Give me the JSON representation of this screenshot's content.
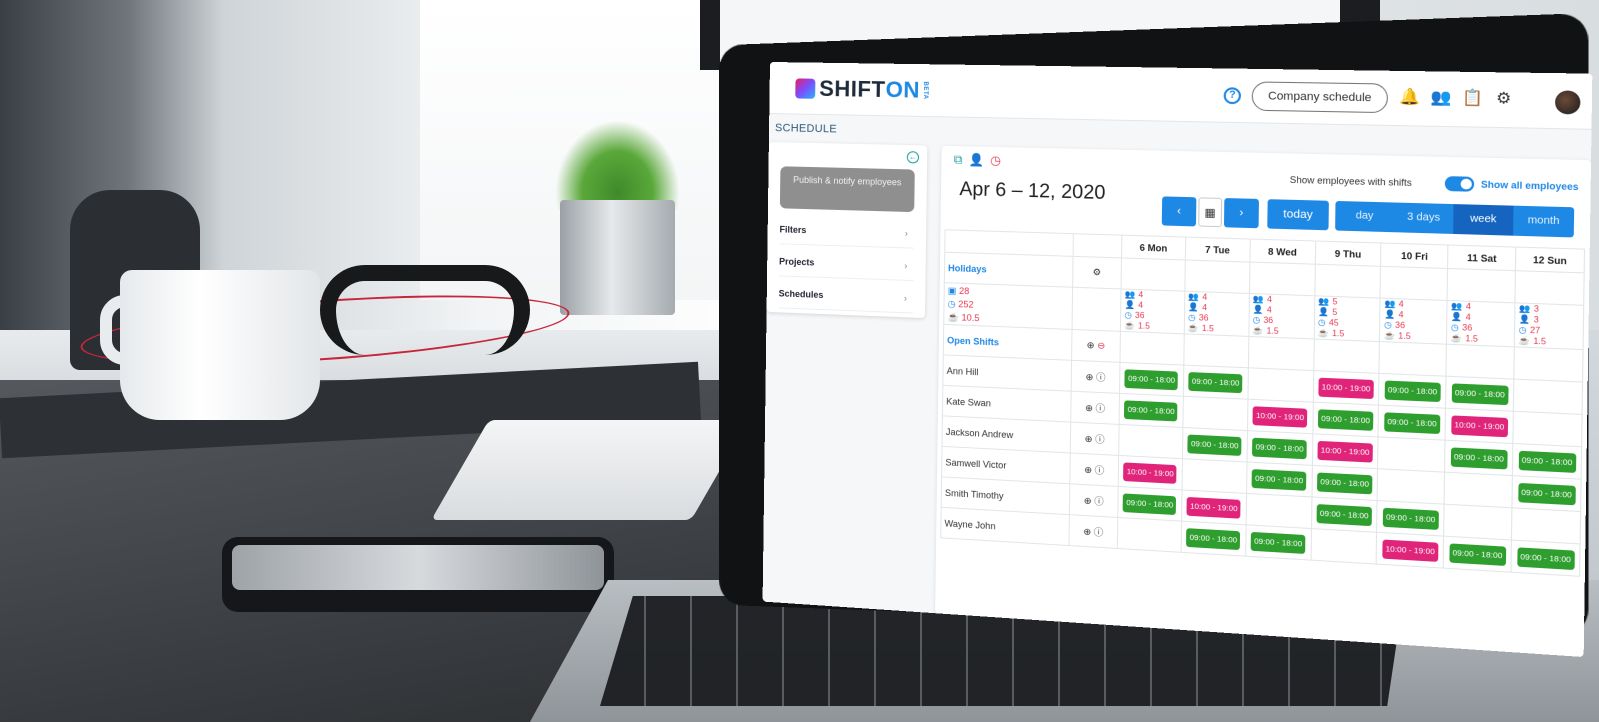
{
  "app": {
    "logo_main": "SHIFT",
    "logo_accent": "ON",
    "logo_badge": "BETA",
    "page_label": "SCHEDULE"
  },
  "topbar": {
    "help": "?",
    "company_schedule": "Company schedule"
  },
  "sidebar": {
    "publish": "Publish & notify employees",
    "items": [
      {
        "label": "Filters"
      },
      {
        "label": "Projects"
      },
      {
        "label": "Schedules"
      }
    ]
  },
  "toolbar": {
    "date_range": "Apr 6 – 12, 2020",
    "show_with_shifts": "Show employees with shifts",
    "show_all": "Show all employees",
    "prev": "‹",
    "next": "›",
    "today": "today",
    "views": [
      "day",
      "3 days",
      "week",
      "month"
    ],
    "active_view": "week"
  },
  "days": [
    "6 Mon",
    "7 Tue",
    "8 Wed",
    "9 Thu",
    "10 Fri",
    "11 Sat",
    "12 Sun"
  ],
  "holidays_label": "Holidays",
  "totals": {
    "shifts": "28",
    "hours": "252",
    "breaks": "10.5"
  },
  "day_stats": [
    [
      "4",
      "4",
      "36",
      "1.5"
    ],
    [
      "4",
      "4",
      "36",
      "1.5"
    ],
    [
      "4",
      "4",
      "36",
      "1.5"
    ],
    [
      "5",
      "5",
      "45",
      "1.5"
    ],
    [
      "4",
      "4",
      "36",
      "1.5"
    ],
    [
      "4",
      "4",
      "36",
      "1.5"
    ],
    [
      "3",
      "3",
      "27",
      "1.5"
    ]
  ],
  "open_shifts_label": "Open Shifts",
  "employees": [
    {
      "name": "Ann Hill",
      "shifts": [
        "09:00 - 18:00",
        "09:00 - 18:00",
        "",
        "10:00 - 19:00",
        "09:00 - 18:00",
        "09:00 - 18:00",
        ""
      ],
      "types": [
        "g",
        "g",
        "",
        "p",
        "g",
        "g",
        ""
      ]
    },
    {
      "name": "Kate Swan",
      "shifts": [
        "09:00 - 18:00",
        "",
        "10:00 - 19:00",
        "09:00 - 18:00",
        "09:00 - 18:00",
        "10:00 - 19:00",
        ""
      ],
      "types": [
        "g",
        "",
        "p",
        "g",
        "g",
        "p",
        ""
      ]
    },
    {
      "name": "Jackson Andrew",
      "shifts": [
        "",
        "09:00 - 18:00",
        "09:00 - 18:00",
        "10:00 - 19:00",
        "",
        "09:00 - 18:00",
        "09:00 - 18:00"
      ],
      "types": [
        "",
        "g",
        "g",
        "p",
        "",
        "g",
        "g"
      ]
    },
    {
      "name": "Samwell Victor",
      "shifts": [
        "10:00 - 19:00",
        "",
        "09:00 - 18:00",
        "09:00 - 18:00",
        "",
        "",
        "09:00 - 18:00"
      ],
      "types": [
        "p",
        "",
        "g",
        "g",
        "",
        "",
        "g"
      ]
    },
    {
      "name": "Smith Timothy",
      "shifts": [
        "09:00 - 18:00",
        "10:00 - 19:00",
        "",
        "09:00 - 18:00",
        "09:00 - 18:00",
        "",
        ""
      ],
      "types": [
        "g",
        "p",
        "",
        "g",
        "g",
        "",
        ""
      ]
    },
    {
      "name": "Wayne John",
      "shifts": [
        "",
        "09:00 - 18:00",
        "09:00 - 18:00",
        "",
        "10:00 - 19:00",
        "09:00 - 18:00",
        "09:00 - 18:00"
      ],
      "types": [
        "",
        "g",
        "g",
        "",
        "p",
        "g",
        "g"
      ]
    }
  ],
  "colors": {
    "accent": "#1e88e5",
    "shift_green": "#2e9e2e",
    "shift_pink": "#e0247a",
    "alert_red": "#e53950"
  }
}
